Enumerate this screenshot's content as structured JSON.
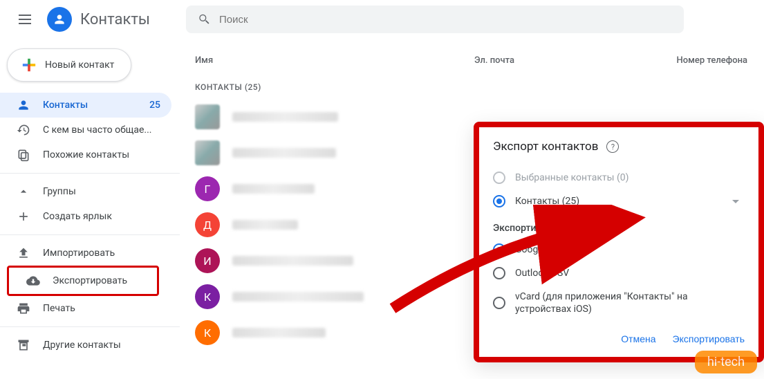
{
  "header": {
    "title": "Контакты",
    "search_placeholder": "Поиск"
  },
  "sidebar": {
    "new_button": "Новый контакт",
    "items": [
      {
        "label": "Контакты",
        "badge": "25"
      },
      {
        "label": "С кем вы часто общае..."
      },
      {
        "label": "Похожие контакты"
      }
    ],
    "groups_label": "Группы",
    "create_label_label": "Создать ярлык",
    "import_label": "Импортировать",
    "export_label": "Экспортировать",
    "print_label": "Печать",
    "other_contacts_label": "Другие контакты"
  },
  "columns": {
    "name": "Имя",
    "email": "Эл. почта",
    "phone": "Номер телефона"
  },
  "section_label": "КОНТАКТЫ (25)",
  "contacts": [
    {
      "letter": "",
      "color": "#dadce0"
    },
    {
      "letter": "",
      "color": "#5f6368"
    },
    {
      "letter": "Г",
      "color": "#9c27b0"
    },
    {
      "letter": "Д",
      "color": "#f44336"
    },
    {
      "letter": "И",
      "color": "#ad1457"
    },
    {
      "letter": "К",
      "color": "#7b1fa2"
    },
    {
      "letter": "К",
      "color": "#ff6d00"
    }
  ],
  "dialog": {
    "title": "Экспорт контактов",
    "opt_selected_disabled": "Выбранные контакты (0)",
    "opt_contacts": "Контакты (25)",
    "export_as_label": "Экспортировать как",
    "fmt_google": "Google CSV",
    "fmt_outlook": "Outlook CSV",
    "fmt_vcard": "vCard (для приложения \"Контакты\" на устройствах iOS)",
    "cancel": "Отмена",
    "export": "Экспортировать"
  },
  "watermark": "hi-tech"
}
